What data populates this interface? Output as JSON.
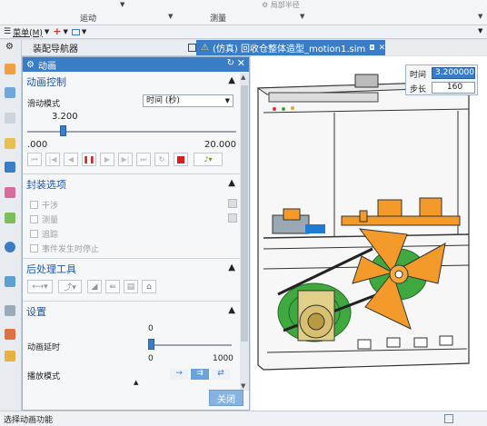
{
  "ribbon": {
    "groups": [
      "运动",
      "测量"
    ],
    "faint_label": "局部半径"
  },
  "menubar": {
    "menu_label": "菜单(M)"
  },
  "navigator": {
    "title": "装配导航器"
  },
  "tab": {
    "title": "(仿真) 回收仓整体造型_motion1.sim"
  },
  "dialog": {
    "title": "动画",
    "animation_control": {
      "header": "动画控制",
      "slide_mode_label": "滑动模式",
      "slide_mode_value": "时间 (秒)",
      "slider_value": "3.200",
      "range_min": ".000",
      "range_max": "20.000",
      "slider_fraction": 0.16
    },
    "packaging": {
      "header": "封装选项",
      "options": [
        "干涉",
        "测量",
        "追踪",
        "事件发生时停止"
      ]
    },
    "postprocess": {
      "header": "后处理工具"
    },
    "settings": {
      "header": "设置",
      "delay_label": "动画延时",
      "delay_value": "0",
      "delay_min": "0",
      "delay_max": "1000",
      "delay_fraction": 0,
      "play_mode_label": "播放模式"
    },
    "close_label": "关闭"
  },
  "time_step": {
    "time_label": "时间",
    "time_value": "3.200000",
    "step_label": "步长",
    "step_value": "160"
  },
  "status": {
    "text": "选择动画功能"
  },
  "colors": {
    "accent": "#3a7dc7",
    "section_header": "#1f57a6",
    "stop_red": "#d32020",
    "viewport_orange": "#f39a2a",
    "viewport_green": "#3fa83f"
  }
}
